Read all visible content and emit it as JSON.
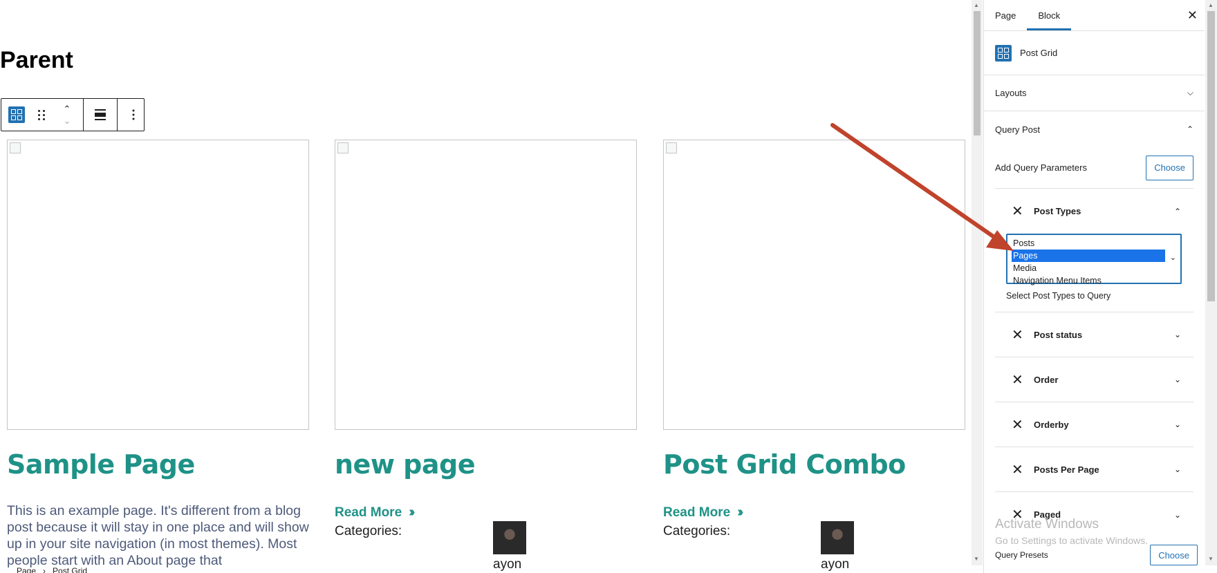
{
  "editor": {
    "page_title": "Parent",
    "toolbar": {
      "block_icon": "post-grid-icon",
      "drag_icon": "drag-handle-icon",
      "move_up_icon": "chevron-up-icon",
      "move_down_icon": "chevron-down-icon",
      "align_icon": "align-icon",
      "more_icon": "more-vertical-icon"
    },
    "posts": [
      {
        "title": "Sample Page",
        "excerpt": "This is an example page. It's different from a blog post because it will stay in one place and will show up in your site navigation (in most themes). Most people start with an About page that"
      },
      {
        "title": "new page",
        "read_more": "Read More",
        "categories_label": "Categories:",
        "author": "ayon"
      },
      {
        "title": "Post Grid Combo",
        "read_more": "Read More",
        "categories_label": "Categories:",
        "author": "ayon"
      }
    ],
    "breadcrumbs": [
      "Page",
      "Post Grid"
    ]
  },
  "sidebar": {
    "tabs": [
      {
        "label": "Page",
        "active": false
      },
      {
        "label": "Block",
        "active": true
      }
    ],
    "close_icon": "close-icon",
    "block_name": "Post Grid",
    "panels": {
      "layouts": "Layouts",
      "query_post": "Query Post"
    },
    "add_query_params_label": "Add Query Parameters",
    "choose_label": "Choose",
    "post_types": {
      "label": "Post Types",
      "options": [
        "Posts",
        "Pages",
        "Media",
        "Navigation Menu Items"
      ],
      "selected": "Pages",
      "help": "Select Post Types to Query"
    },
    "params": [
      "Post status",
      "Order",
      "Orderby",
      "Posts Per Page",
      "Paged"
    ],
    "query_presets_label": "Query Presets",
    "watermark": {
      "line1": "Activate Windows",
      "line2": "Go to Settings to activate Windows."
    }
  },
  "colors": {
    "accent": "#2271b1",
    "post_title": "#1f9287",
    "annotation_arrow": "#c0432b"
  }
}
